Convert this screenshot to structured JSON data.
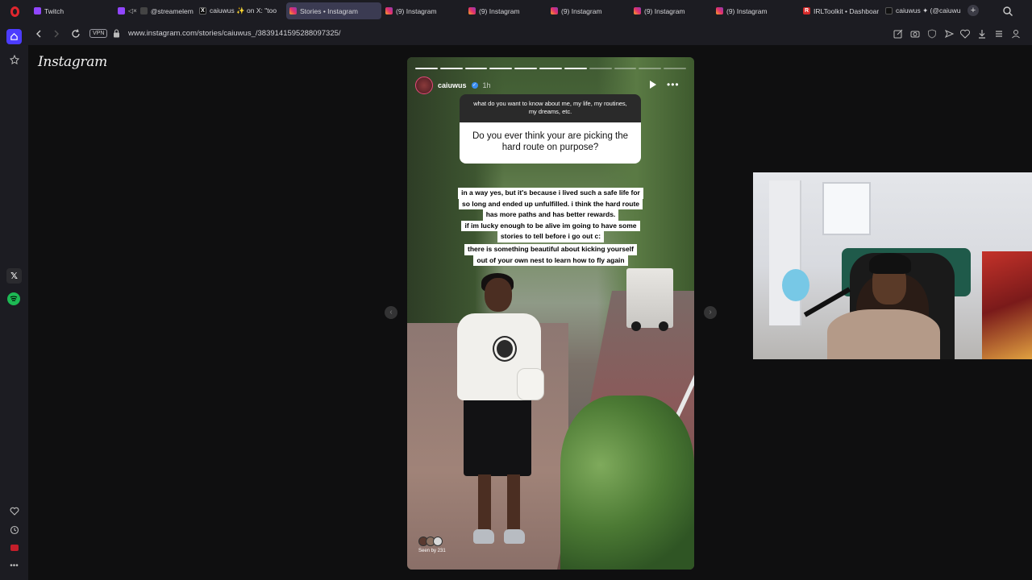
{
  "tabs": [
    {
      "label": "Twitch",
      "icon": "twitch-icon",
      "active": false
    },
    {
      "label": "@streamelem",
      "icon": "streamelements-icon",
      "active": false
    },
    {
      "label": "caiuwus ✨ on X: \"too",
      "icon": "x-icon",
      "active": false
    },
    {
      "label": "Stories • Instagram",
      "icon": "instagram-icon",
      "active": true
    },
    {
      "label": "(9) Instagram",
      "icon": "instagram-icon",
      "active": false
    },
    {
      "label": "(9) Instagram",
      "icon": "instagram-icon",
      "active": false
    },
    {
      "label": "(9) Instagram",
      "icon": "instagram-icon",
      "active": false
    },
    {
      "label": "(9) Instagram",
      "icon": "instagram-icon",
      "active": false
    },
    {
      "label": "(9) Instagram",
      "icon": "instagram-icon",
      "active": false
    },
    {
      "label": "IRLToolkit • Dashboard",
      "icon": "irltoolkit-icon",
      "active": false
    },
    {
      "label": "caiuwus ✦ (@caiuwus",
      "icon": "tiktok-icon",
      "active": false
    }
  ],
  "address": {
    "vpn_label": "VPN",
    "url": "www.instagram.com/stories/caiuwus_/3839141595288097325/"
  },
  "page": {
    "logo": "Instagram"
  },
  "story": {
    "username": "caiuwus",
    "time": "1h",
    "progress_total": 11,
    "progress_done": 7,
    "question_prompt": "what do you want to know about me, my life, my routines, my dreams, etc.",
    "question": "Do you ever think your are picking the hard route on purpose?",
    "answer_lines_1": [
      "in a way yes, but it's because i lived such a safe life for",
      "so long and ended up unfulfilled. i think the hard route",
      "has more paths and has better rewards.",
      "if im lucky enough to be alive im going to have some",
      "stories to tell before i go out c:"
    ],
    "answer_lines_2": [
      "there is something beautiful about kicking yourself",
      "out of your own nest to learn how to fly again"
    ],
    "seen_by": "Seen by 231"
  },
  "colors": {
    "accent": "#4c3cff",
    "opera_red": "#e0262e",
    "spotify_green": "#1db954"
  }
}
